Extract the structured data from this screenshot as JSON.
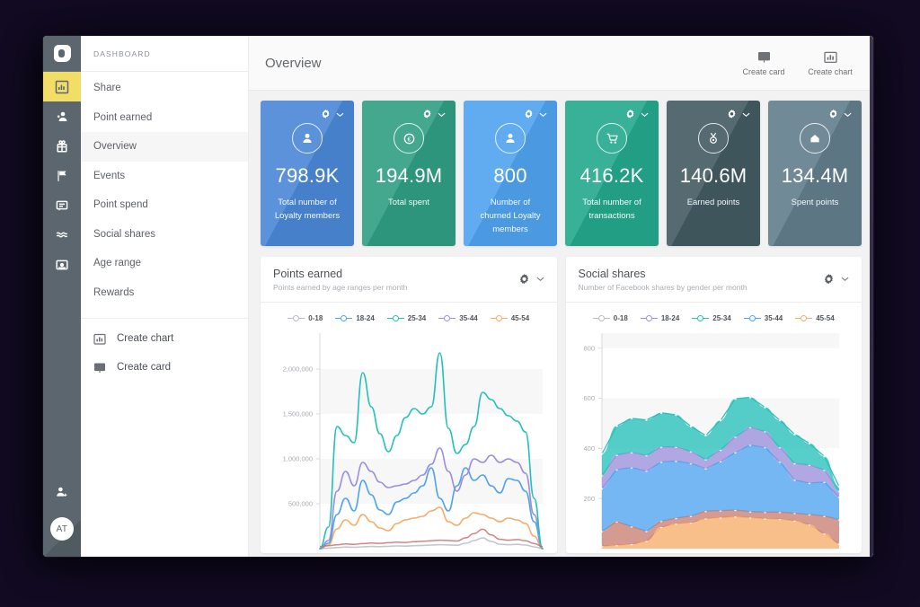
{
  "rail": {
    "logo": "app-logo",
    "items": [
      {
        "name": "chart-icon",
        "active": true
      },
      {
        "name": "users-icon",
        "active": false
      },
      {
        "name": "gift-icon",
        "active": false
      },
      {
        "name": "flag-icon",
        "active": false
      },
      {
        "name": "message-icon",
        "active": false
      },
      {
        "name": "waves-icon",
        "active": false
      },
      {
        "name": "inbox-icon",
        "active": false
      }
    ],
    "bottom_icon": "add-user-icon",
    "avatar_initials": "AT"
  },
  "sidebar": {
    "section_title": "DASHBOARD",
    "items": [
      {
        "label": "Share",
        "selected": false
      },
      {
        "label": "Point earned",
        "selected": false
      },
      {
        "label": "Overview",
        "selected": true
      },
      {
        "label": "Events",
        "selected": false
      },
      {
        "label": "Point spend",
        "selected": false
      },
      {
        "label": "Social shares",
        "selected": false
      },
      {
        "label": "Age range",
        "selected": false
      },
      {
        "label": "Rewards",
        "selected": false
      }
    ],
    "actions": [
      {
        "label": "Create chart",
        "icon": "chart-icon"
      },
      {
        "label": "Create card",
        "icon": "card-icon"
      }
    ]
  },
  "header": {
    "title": "Overview",
    "actions": [
      {
        "label": "Create card",
        "icon": "card-icon"
      },
      {
        "label": "Create chart",
        "icon": "chart-icon"
      }
    ]
  },
  "cards": [
    {
      "value": "798.9K",
      "label": "Total number of Loyalty members",
      "icon": "person-icon",
      "color": "#4a86d6"
    },
    {
      "value": "194.9M",
      "label": "Total spent",
      "icon": "coin-icon",
      "color": "#2f9e82"
    },
    {
      "value": "800",
      "label": "Number of churned Loyalty members",
      "icon": "person-icon",
      "color": "#4fa3ee"
    },
    {
      "value": "416.2K",
      "label": "Total number of transactions",
      "icon": "cart-icon",
      "color": "#23a78c"
    },
    {
      "value": "140.6M",
      "label": "Earned points",
      "icon": "medal-icon",
      "color": "#435a61"
    },
    {
      "value": "134.4M",
      "label": "Spent points",
      "icon": "home-icon",
      "color": "#617d8c"
    }
  ],
  "chart_data": [
    {
      "type": "line",
      "title": "Points earned",
      "subtitle": "Points earned by age ranges per month",
      "xlabel": "",
      "ylabel": "",
      "ylim": [
        0,
        2400000
      ],
      "yticks": [
        500000,
        1000000,
        1500000,
        2000000
      ],
      "ytick_labels": [
        "500,000",
        "1,000,000",
        "1,500,000",
        "2,000,000"
      ],
      "grid": true,
      "legend_position": "top",
      "legend": [
        "0-18",
        "18-24",
        "25-34",
        "35-44",
        "45-54"
      ],
      "colors": [
        "#b9bdc4",
        "#4da3ef",
        "#26c0ba",
        "#9b8fdb",
        "#f6ad6a"
      ],
      "x": [
        0,
        1,
        2,
        3,
        4,
        5,
        6,
        7,
        8,
        9,
        10,
        11,
        12,
        13,
        14,
        15,
        16,
        17,
        18,
        19,
        20,
        21,
        22,
        23,
        24,
        25,
        26
      ],
      "series": [
        {
          "name": "0-18",
          "color": "#b9bdc4",
          "values": [
            0,
            5000,
            12000,
            18000,
            15000,
            20000,
            24000,
            22000,
            26000,
            30000,
            28000,
            33000,
            36000,
            40000,
            44000,
            41000,
            38000,
            60000,
            90000,
            120000,
            80000,
            50000,
            44000,
            48000,
            40000,
            20000,
            0
          ]
        },
        {
          "name": "18-24",
          "color": "#4da3ef",
          "values": [
            0,
            60000,
            380000,
            560000,
            420000,
            760000,
            600000,
            430000,
            380000,
            520000,
            560000,
            620000,
            700000,
            900000,
            560000,
            420000,
            700000,
            900000,
            760000,
            820000,
            700000,
            620000,
            780000,
            760000,
            640000,
            300000,
            0
          ]
        },
        {
          "name": "25-34",
          "color": "#26c0ba",
          "values": [
            0,
            240000,
            1360000,
            1260000,
            1180000,
            1960000,
            1580000,
            1280000,
            1080000,
            1260000,
            1460000,
            1560000,
            1500000,
            1580000,
            2180000,
            1340000,
            1060000,
            1160000,
            1360000,
            1740000,
            1660000,
            1560000,
            1480000,
            1420000,
            1300000,
            560000,
            0
          ]
        },
        {
          "name": "35-44",
          "color": "#9b8fdb",
          "values": [
            0,
            90000,
            640000,
            860000,
            700000,
            960000,
            860000,
            740000,
            680000,
            700000,
            720000,
            760000,
            820000,
            940000,
            1120000,
            860000,
            640000,
            820000,
            1000000,
            960000,
            1040000,
            960000,
            1000000,
            960000,
            840000,
            380000,
            0
          ]
        },
        {
          "name": "45-54",
          "color": "#f6ad6a",
          "values": [
            0,
            40000,
            220000,
            320000,
            260000,
            380000,
            300000,
            230000,
            200000,
            280000,
            320000,
            340000,
            360000,
            420000,
            460000,
            300000,
            260000,
            340000,
            400000,
            380000,
            340000,
            300000,
            340000,
            320000,
            280000,
            140000,
            0
          ]
        }
      ]
    },
    {
      "type": "area",
      "stacked": true,
      "title": "Social shares",
      "subtitle": "Number of Facebook shares by gender per month",
      "xlabel": "",
      "ylabel": "",
      "ylim": [
        0,
        860
      ],
      "yticks": [
        200,
        400,
        600,
        800
      ],
      "ytick_labels": [
        "200",
        "400",
        "600",
        "800"
      ],
      "grid": true,
      "legend_position": "top",
      "legend": [
        "0-18",
        "18-24",
        "25-34",
        "35-44",
        "45-54"
      ],
      "colors": [
        "#b9bdc4",
        "#9b8fdb",
        "#26c0ba",
        "#4da3ef",
        "#f6ad6a"
      ],
      "x": [
        0,
        1,
        2,
        3,
        4,
        5,
        6,
        7,
        8,
        9,
        10,
        11,
        12,
        13,
        14,
        15,
        16
      ],
      "series": [
        {
          "name": "45-54",
          "color": "#f6ad6a",
          "values": [
            10,
            14,
            18,
            30,
            86,
            100,
            104,
            120,
            124,
            128,
            124,
            120,
            118,
            112,
            96,
            60,
            20
          ]
        },
        {
          "name": "0-18",
          "color": "#c97f72",
          "values": [
            60,
            94,
            70,
            40,
            24,
            22,
            26,
            30,
            28,
            26,
            24,
            26,
            28,
            30,
            40,
            70,
            96
          ]
        },
        {
          "name": "35-44",
          "color": "#4da3ef",
          "values": [
            170,
            208,
            236,
            240,
            236,
            228,
            210,
            170,
            196,
            230,
            266,
            258,
            200,
            132,
            126,
            136,
            90
          ]
        },
        {
          "name": "18-24",
          "color": "#9b8fdb",
          "values": [
            52,
            58,
            60,
            62,
            60,
            56,
            48,
            36,
            46,
            62,
            70,
            64,
            58,
            66,
            72,
            48,
            24
          ]
        },
        {
          "name": "25-34",
          "color": "#26c0ba",
          "values": [
            86,
            116,
            136,
            142,
            136,
            128,
            100,
            96,
            118,
            152,
            120,
            96,
            108,
            116,
            86,
            54,
            18
          ]
        }
      ]
    }
  ]
}
